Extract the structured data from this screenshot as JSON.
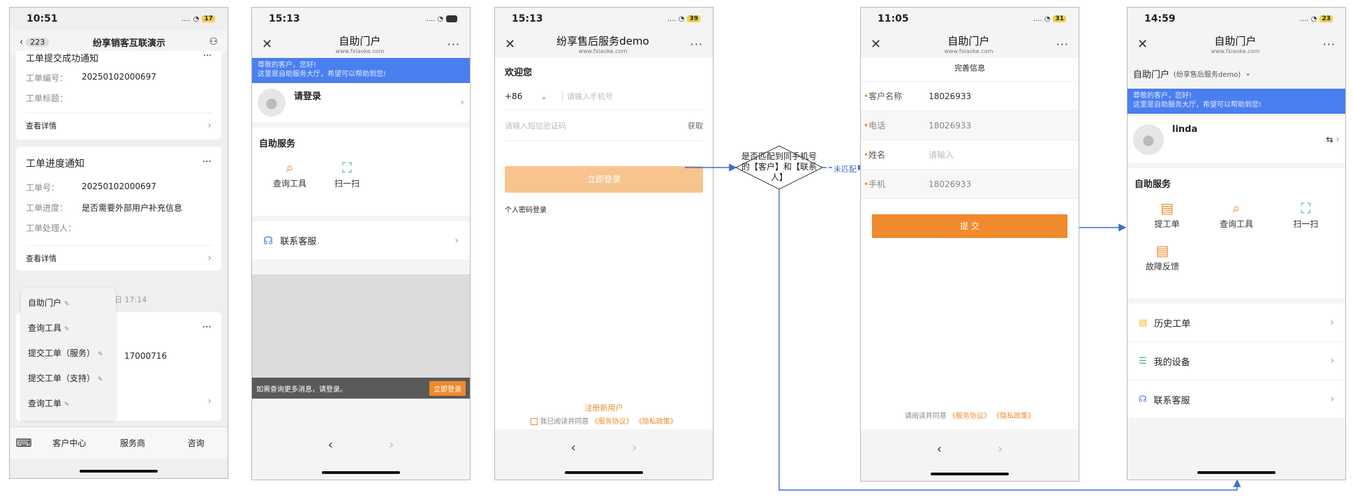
{
  "phone1": {
    "time": "10:51",
    "battery": "17",
    "back_count": "223",
    "title": "纷享销客互联演示",
    "card1": {
      "title": "工单提交成功通知",
      "no_label": "工单编号：",
      "no_value": "20250102000697",
      "title_label": "工单标题：",
      "title_value": "",
      "detail": "查看详情"
    },
    "card2": {
      "title": "工单进度通知",
      "no_label": "工单号：",
      "no_value": "20250102000697",
      "progress_label": "工单进度：",
      "progress_value": "是否需要外部用户补充信息",
      "handler_label": "工单处理人：",
      "handler_value": "",
      "detail": "查看详情"
    },
    "date_partial": "日 17:14",
    "card3_partial_no": "17000716",
    "menu": [
      "自助门户",
      "查询工具",
      "提交工单（服务）",
      "提交工单（支持）",
      "查询工单"
    ],
    "tabs": [
      "客户中心",
      "服务商",
      "咨询"
    ]
  },
  "phone2": {
    "time": "15:13",
    "battery": "",
    "title": "自助门户",
    "domain": "www.fxiaoke.com",
    "banner_line1": "尊敬的客户，您好!",
    "banner_line2": "这里是自助服务大厅，希望可以帮助到您!",
    "login": "请登录",
    "section": "自助服务",
    "tiles": [
      "查询工具",
      "扫一扫"
    ],
    "contact": "联系客服",
    "login_bar_text": "如需查询更多消息，请登录。",
    "login_bar_btn": "立即登录"
  },
  "phone3": {
    "time": "15:13",
    "battery": "39",
    "title": "纷享售后服务demo",
    "domain": "www.fxiaoke.com",
    "welcome": "欢迎您",
    "cc": "+86",
    "phone_placeholder": "请输入手机号",
    "sms_placeholder": "请输入短信验证码",
    "get_code": "获取",
    "login_btn": "立即登录",
    "pwd_login": "个人密码登录",
    "register": "注册新用户",
    "agree_prefix": "我已阅读并同意",
    "service_agreement": "《服务协议》",
    "privacy": "《隐私政策》"
  },
  "decision": {
    "text": "是否匹配到同手机号的【客户】和【联系人】",
    "no_match": "未匹配"
  },
  "phone4": {
    "time": "11:05",
    "battery": "31",
    "title": "自助门户",
    "domain": "www.fxiaoke.com",
    "header": "完善信息",
    "fields": [
      {
        "label": "客户名称",
        "value": "18026933"
      },
      {
        "label": "电话",
        "value": "18026933"
      },
      {
        "label": "姓名",
        "value": "请输入"
      },
      {
        "label": "手机",
        "value": "18026933"
      }
    ],
    "submit": "提 交",
    "agree_prefix": "请阅读并同意",
    "service_agreement": "《服务协议》",
    "privacy": "《隐私政策》"
  },
  "phone5": {
    "time": "14:59",
    "battery": "23",
    "title": "自助门户",
    "domain": "www.fxiaoke.com",
    "portal_label": "自助门户",
    "portal_sub": "(纷享售后服务demo)",
    "banner_line1": "尊敬的客户，您好!",
    "banner_line2": "这里是自助服务大厅，希望可以帮助到您!",
    "user": "linda",
    "section": "自助服务",
    "tiles": [
      "提工单",
      "查询工具",
      "扫一扫",
      "故障反馈"
    ],
    "list": [
      "历史工单",
      "我的设备",
      "联系客服"
    ]
  }
}
